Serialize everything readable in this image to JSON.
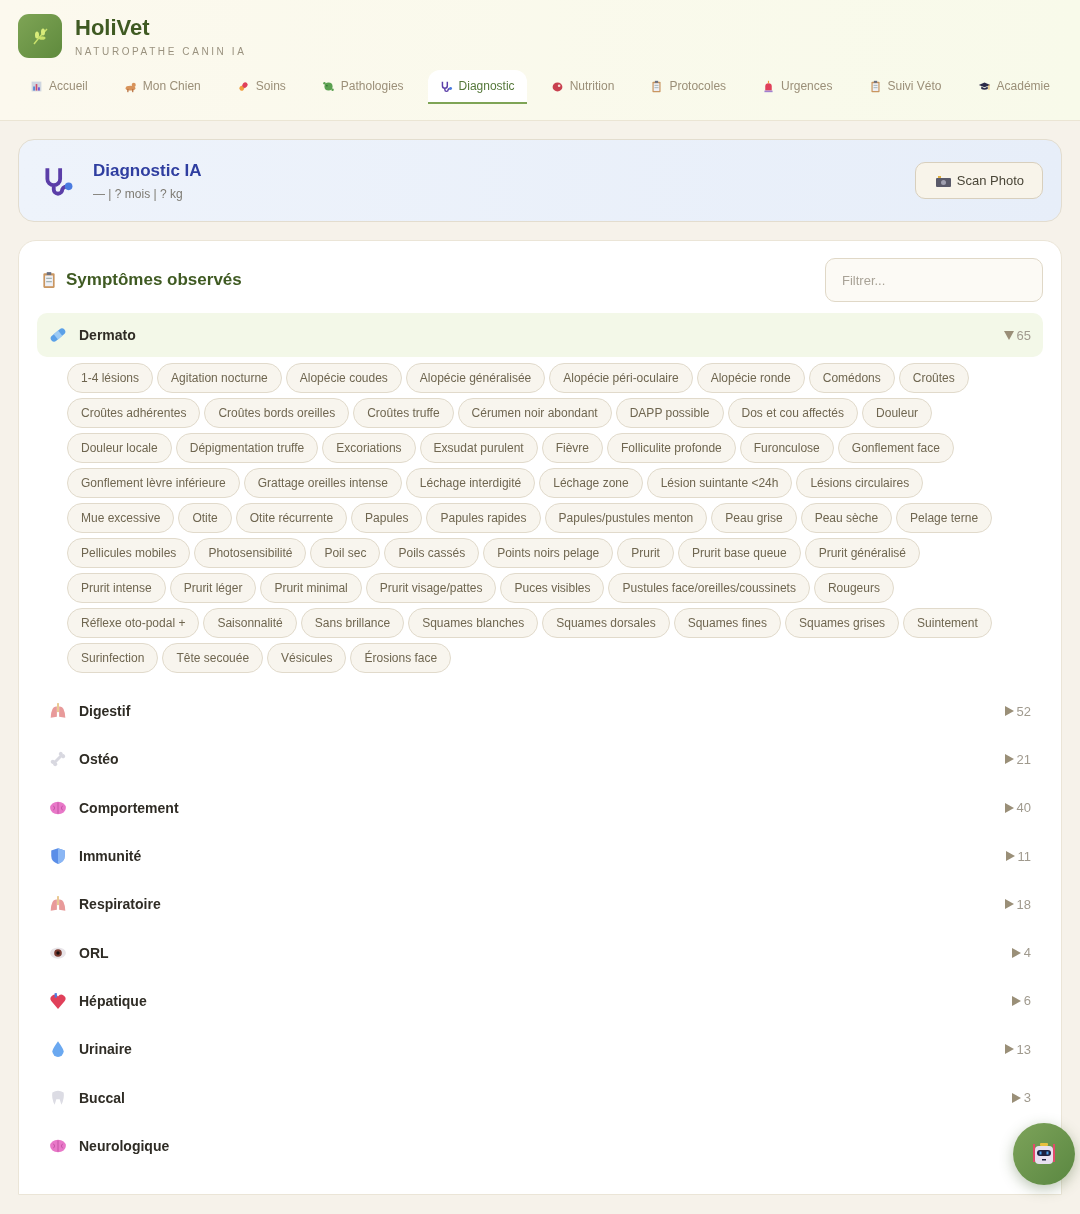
{
  "app": {
    "name": "HoliVet",
    "tagline": "NATUROPATHE CANIN IA"
  },
  "tabs": [
    {
      "label": "Accueil",
      "selected": false
    },
    {
      "label": "Mon Chien",
      "selected": false
    },
    {
      "label": "Soins",
      "selected": false
    },
    {
      "label": "Pathologies",
      "selected": false
    },
    {
      "label": "Diagnostic",
      "selected": true
    },
    {
      "label": "Nutrition",
      "selected": false
    },
    {
      "label": "Protocoles",
      "selected": false
    },
    {
      "label": "Urgences",
      "selected": false
    },
    {
      "label": "Suivi Véto",
      "selected": false
    },
    {
      "label": "Académie",
      "selected": false
    }
  ],
  "banner": {
    "title": "Diagnostic IA",
    "subtitle": "— | ? mois | ? kg",
    "button": "Scan Photo"
  },
  "symptoms": {
    "title": "Symptômes observés",
    "filter": {
      "placeholder": "Filtrer..."
    },
    "groups": [
      {
        "name": "Dermato",
        "expanded": true,
        "count": "65",
        "chips": [
          "1-4 lésions",
          "Agitation nocturne",
          "Alopécie coudes",
          "Alopécie généralisée",
          "Alopécie péri-oculaire",
          "Alopécie ronde",
          "Comédons",
          "Croûtes",
          "Croûtes adhérentes",
          "Croûtes bords oreilles",
          "Croûtes truffe",
          "Cérumen noir abondant",
          "DAPP possible",
          "Dos et cou affectés",
          "Douleur",
          "Douleur locale",
          "Dépigmentation truffe",
          "Excoriations",
          "Exsudat purulent",
          "Fièvre",
          "Folliculite profonde",
          "Furonculose",
          "Gonflement face",
          "Gonflement lèvre inférieure",
          "Grattage oreilles intense",
          "Léchage interdigité",
          "Léchage zone",
          "Lésion suintante <24h",
          "Lésions circulaires",
          "Mue excessive",
          "Otite",
          "Otite récurrente",
          "Papules",
          "Papules rapides",
          "Papules/pustules menton",
          "Peau grise",
          "Peau sèche",
          "Pelage terne",
          "Pellicules mobiles",
          "Photosensibilité",
          "Poil sec",
          "Poils cassés",
          "Points noirs pelage",
          "Prurit",
          "Prurit base queue",
          "Prurit généralisé",
          "Prurit intense",
          "Prurit léger",
          "Prurit minimal",
          "Prurit visage/pattes",
          "Puces visibles",
          "Pustules face/oreilles/coussinets",
          "Rougeurs",
          "Réflexe oto-podal +",
          "Saisonnalité",
          "Sans brillance",
          "Squames blanches",
          "Squames dorsales",
          "Squames fines",
          "Squames grises",
          "Suintement",
          "Surinfection",
          "Tête secouée",
          "Vésicules",
          "Érosions face"
        ]
      },
      {
        "name": "Digestif",
        "expanded": false,
        "count": "52"
      },
      {
        "name": "Ostéo",
        "expanded": false,
        "count": "21"
      },
      {
        "name": "Comportement",
        "expanded": false,
        "count": "40"
      },
      {
        "name": "Immunité",
        "expanded": false,
        "count": "11"
      },
      {
        "name": "Respiratoire",
        "expanded": false,
        "count": "18"
      },
      {
        "name": "ORL",
        "expanded": false,
        "count": "4"
      },
      {
        "name": "Hépatique",
        "expanded": false,
        "count": "6"
      },
      {
        "name": "Urinaire",
        "expanded": false,
        "count": "13"
      },
      {
        "name": "Buccal",
        "expanded": false,
        "count": "3"
      },
      {
        "name": "Neurologique",
        "expanded": false
      }
    ]
  }
}
